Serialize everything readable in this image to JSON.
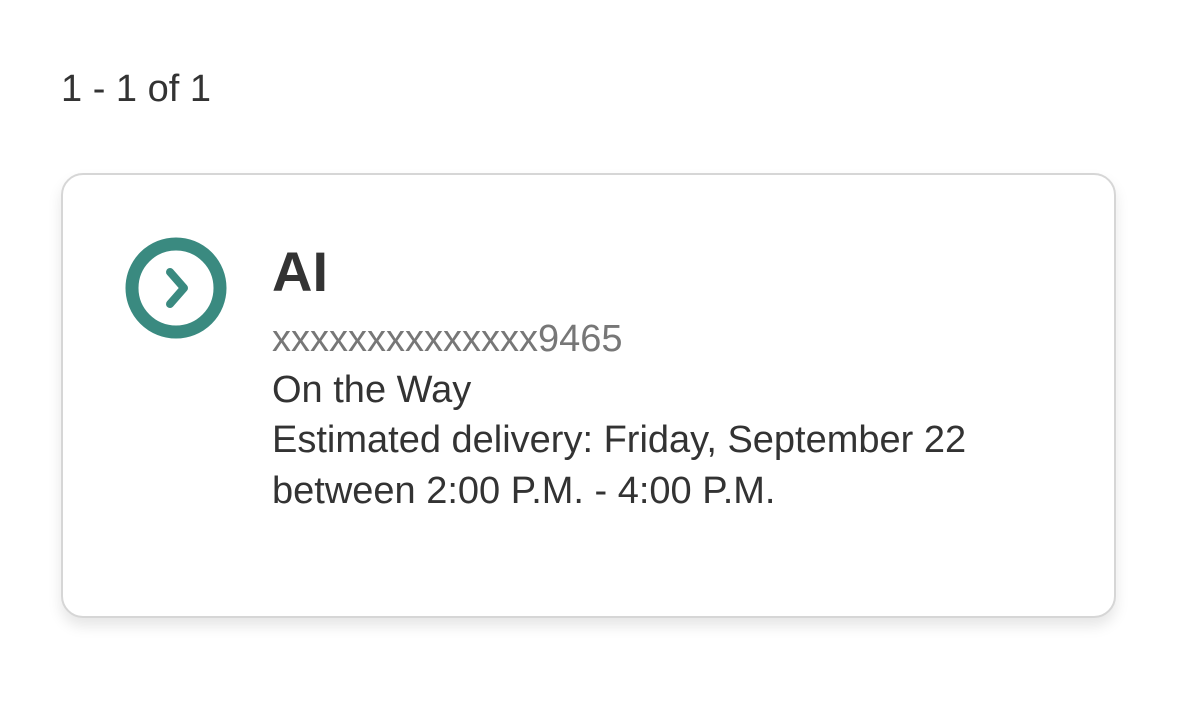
{
  "results": {
    "count_text": "1 - 1 of 1"
  },
  "shipments": [
    {
      "name": "AI",
      "tracking_number": "xxxxxxxxxxxxxx9465",
      "status": "On the Way",
      "delivery_line1": "Estimated delivery: Friday, September 22",
      "delivery_line2": "between 2:00 P.M. - 4:00 P.M.",
      "icon": "chevron-right-circle-icon",
      "accent_color": "#3a8a80"
    }
  ]
}
